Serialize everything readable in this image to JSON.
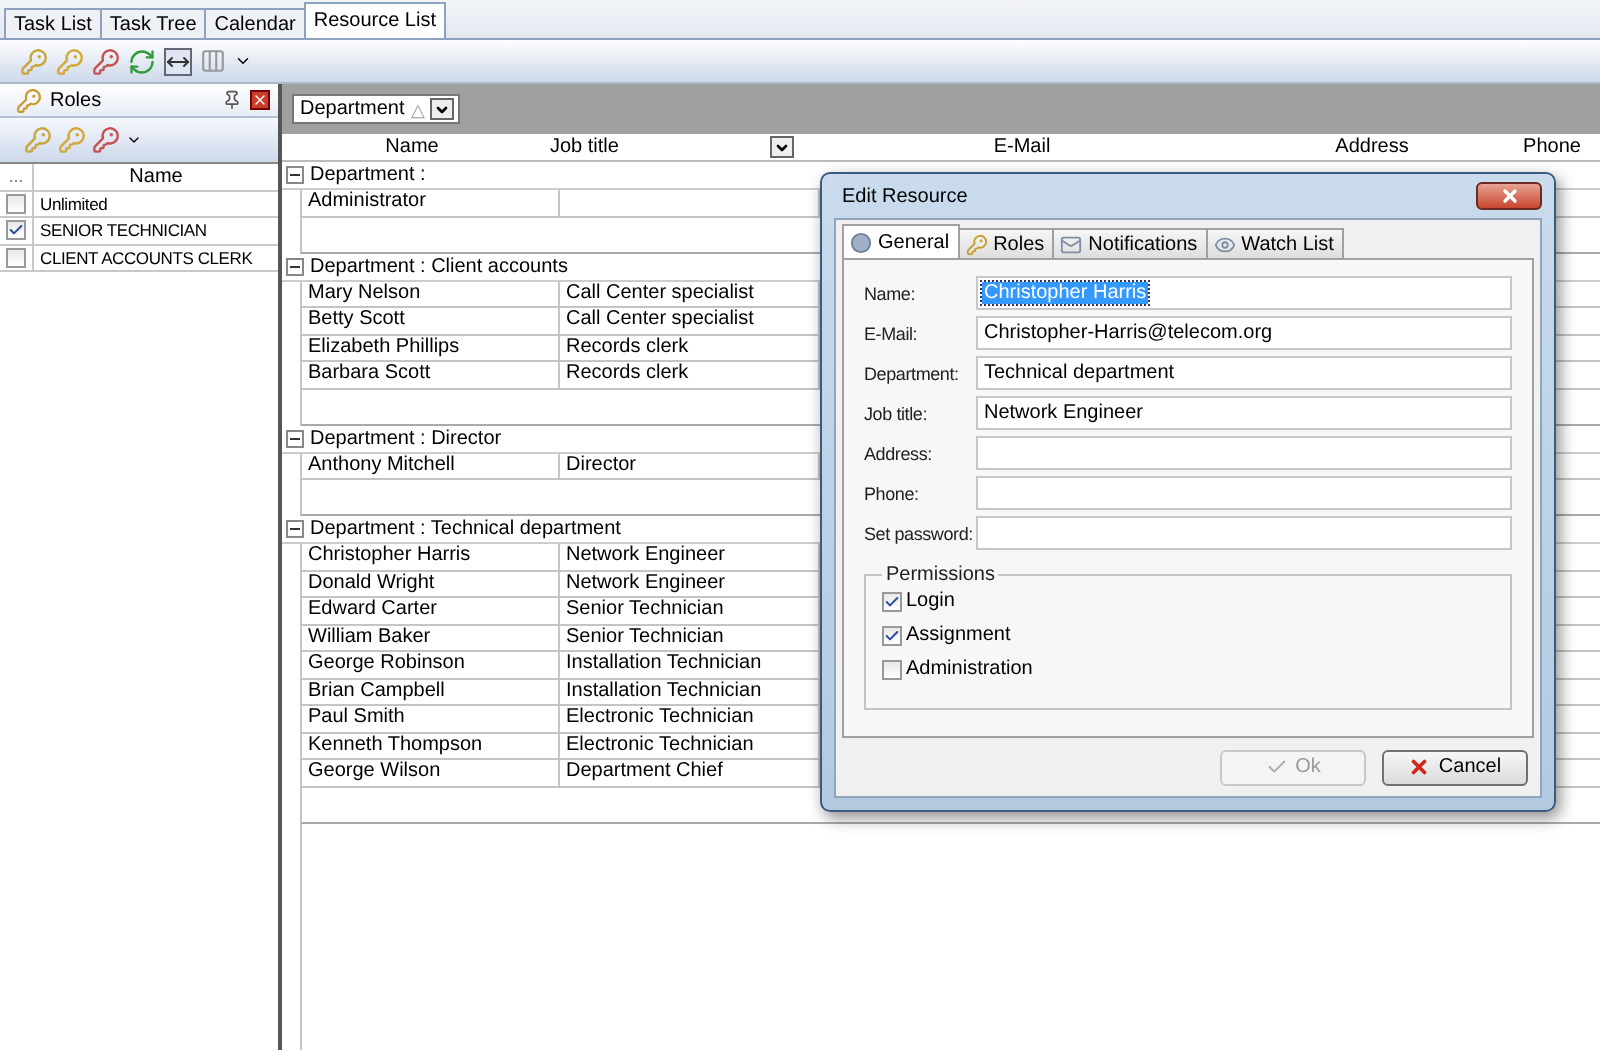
{
  "tabs": [
    {
      "label": "Task List",
      "selected": false
    },
    {
      "label": "Task Tree",
      "selected": false
    },
    {
      "label": "Calendar",
      "selected": false
    },
    {
      "label": "Resource List",
      "selected": true
    }
  ],
  "roles_panel": {
    "title": "Roles",
    "columns": [
      "...",
      "Name"
    ],
    "rows": [
      {
        "name": "Unlimited",
        "checked": false
      },
      {
        "name": "SENIOR TECHNICIAN",
        "checked": true
      },
      {
        "name": "CLIENT ACCOUNTS CLERK",
        "checked": false
      }
    ]
  },
  "group_by": {
    "label": "Department",
    "glyph": "△"
  },
  "grid": {
    "columns": [
      "Name",
      "Job title",
      "E-Mail",
      "Address",
      "Phone"
    ],
    "groups": [
      {
        "title": "Department :",
        "expanded": true,
        "rows": [
          [
            "Administrator",
            ""
          ]
        ]
      },
      {
        "title": "Department : Client accounts",
        "expanded": true,
        "rows": [
          [
            "Mary Nelson",
            "Call Center specialist"
          ],
          [
            "Betty Scott",
            "Call Center specialist"
          ],
          [
            "Elizabeth Phillips",
            "Records clerk"
          ],
          [
            "Barbara Scott",
            "Records clerk"
          ]
        ]
      },
      {
        "title": "Department : Director",
        "expanded": true,
        "rows": [
          [
            "Anthony Mitchell",
            "Director"
          ]
        ]
      },
      {
        "title": "Department : Technical department",
        "expanded": true,
        "rows": [
          [
            "Christopher Harris",
            "Network Engineer"
          ],
          [
            "Donald Wright",
            "Network Engineer"
          ],
          [
            "Edward Carter",
            "Senior Technician"
          ],
          [
            "William Baker",
            "Senior Technician"
          ],
          [
            "George Robinson",
            "Installation Technician"
          ],
          [
            "Brian Campbell",
            "Installation Technician"
          ],
          [
            "Paul Smith",
            "Electronic Technician"
          ],
          [
            "Kenneth Thompson",
            "Electronic Technician"
          ],
          [
            "George Wilson",
            "Department Chief"
          ]
        ]
      }
    ]
  },
  "dialog": {
    "title": "Edit Resource",
    "tabs": [
      {
        "label": "General",
        "kind": "general",
        "selected": true
      },
      {
        "label": "Roles",
        "kind": "roles",
        "selected": false
      },
      {
        "label": "Notifications",
        "kind": "notifications",
        "selected": false
      },
      {
        "label": "Watch List",
        "kind": "watch",
        "selected": false
      }
    ],
    "fields": [
      {
        "label": "Name:",
        "value": "Christopher Harris",
        "highlighted": true
      },
      {
        "label": "E-Mail:",
        "value": "Christopher-Harris@telecom.org",
        "highlighted": false
      },
      {
        "label": "Department:",
        "value": "Technical department",
        "highlighted": false
      },
      {
        "label": "Job title:",
        "value": "Network Engineer",
        "highlighted": false
      },
      {
        "label": "Address:"
      },
      {
        "label": "Phone:"
      },
      {
        "label": "Set password:"
      }
    ],
    "permissions": {
      "title": "Permissions",
      "items": [
        {
          "label": "Login",
          "checked": true
        },
        {
          "label": "Assignment",
          "checked": true
        },
        {
          "label": "Administration",
          "checked": false
        }
      ]
    },
    "buttons": [
      {
        "label": "Ok",
        "kind": "ok",
        "disabled": true
      },
      {
        "label": "Cancel",
        "kind": "cancel",
        "disabled": false
      }
    ]
  }
}
